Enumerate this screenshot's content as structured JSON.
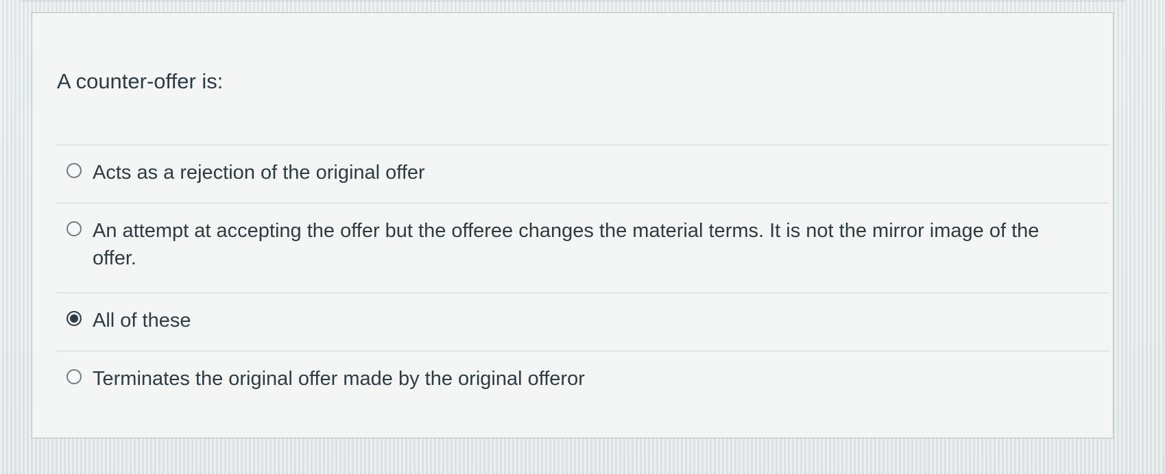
{
  "question": {
    "text": "A counter-offer is:"
  },
  "answers": [
    {
      "label": "Acts as a rejection of the original offer",
      "selected": false
    },
    {
      "label": "An attempt at accepting the offer but the offeree changes the material terms. It is not the mirror image of the offer.",
      "selected": false
    },
    {
      "label": "All of these",
      "selected": true
    },
    {
      "label": "Terminates the original offer made by the original offeror",
      "selected": false
    }
  ],
  "colors": {
    "text": "#2d3b45",
    "divider": "#cfd4d6",
    "card_border": "#b9bfc3"
  }
}
